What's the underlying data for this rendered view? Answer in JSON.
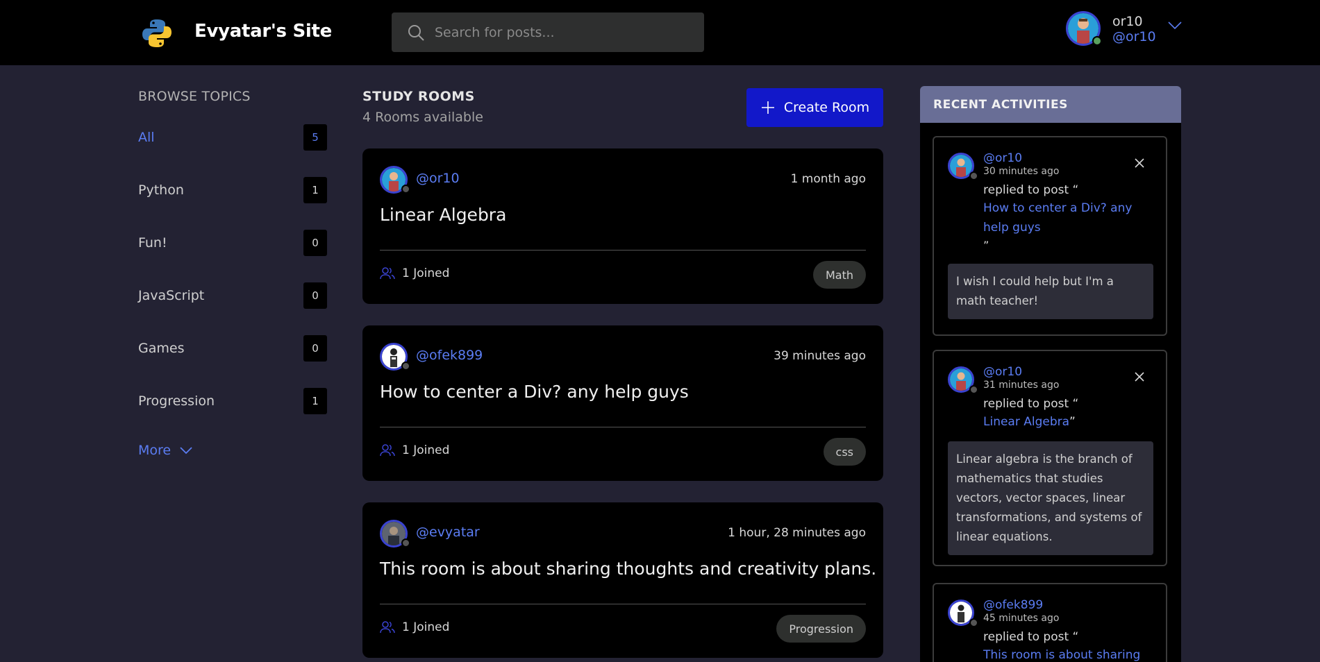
{
  "header": {
    "site_title": "Evyatar's Site",
    "search_placeholder": "Search for posts...",
    "user": {
      "name": "or10",
      "handle": "@or10"
    }
  },
  "sidebar": {
    "heading": "BROWSE TOPICS",
    "topics": [
      {
        "name": "All",
        "count": "5"
      },
      {
        "name": "Python",
        "count": "1"
      },
      {
        "name": "Fun!",
        "count": "0"
      },
      {
        "name": "JavaScript",
        "count": "0"
      },
      {
        "name": "Games",
        "count": "0"
      },
      {
        "name": "Progression",
        "count": "1"
      }
    ],
    "more_label": "More"
  },
  "main": {
    "heading": "STUDY ROOMS",
    "count_label": "4 Rooms available",
    "create_label": "Create Room",
    "rooms": [
      {
        "author": "@or10",
        "time": "1 month ago",
        "title": "Linear Algebra",
        "joined": "1 Joined",
        "tag": "Math"
      },
      {
        "author": "@ofek899",
        "time": "39 minutes ago",
        "title": "How to center a Div? any help guys",
        "joined": "1 Joined",
        "tag": "css"
      },
      {
        "author": "@evyatar",
        "time": "1 hour, 28 minutes ago",
        "title": "This room is about sharing thoughts and creativity plans.",
        "joined": "1 Joined",
        "tag": "Progression"
      }
    ]
  },
  "activity": {
    "heading": "RECENT ACTIVITIES",
    "items": [
      {
        "author": "@or10",
        "time": "30 minutes ago",
        "replied": "replied to post “",
        "link": "How to center a Div? any help guys",
        "quote_end": "”",
        "body": "I wish I could help but I'm a math teacher!"
      },
      {
        "author": "@or10",
        "time": "31 minutes ago",
        "replied": "replied to post “",
        "link": "Linear Algebra",
        "quote_end": "”",
        "body": "Linear algebra is the branch of mathematics that studies vectors, vector spaces, linear transformations, and systems of linear equations."
      },
      {
        "author": "@ofek899",
        "time": "45 minutes ago",
        "replied": "replied to post “",
        "link": "This room is about sharing",
        "quote_end": "",
        "body": ""
      }
    ]
  },
  "colors": {
    "accent": "#5b7df3",
    "button": "#1218c9",
    "page_bg": "#232233",
    "card_bg": "#000000",
    "activity_header": "#696e96",
    "online": "#5aa05f"
  }
}
